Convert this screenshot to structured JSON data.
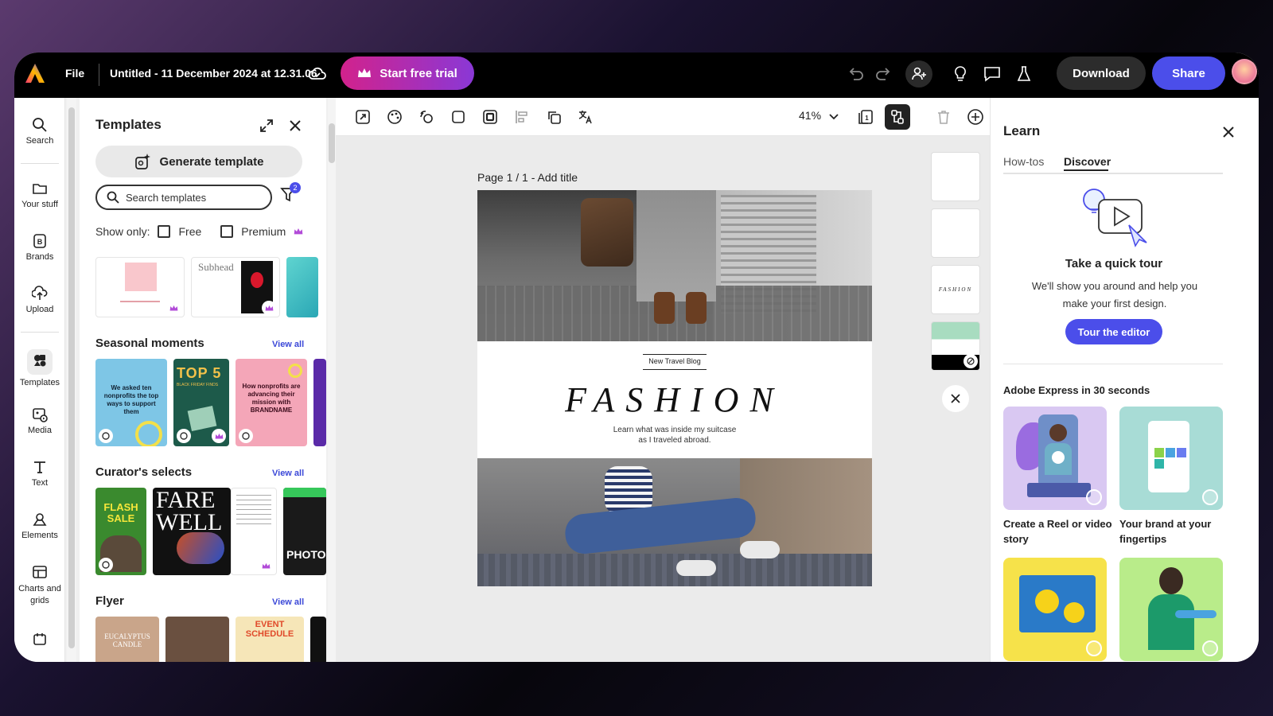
{
  "topbar": {
    "file_label": "File",
    "doc_title": "Untitled - 11 December 2024 at 12.31.06",
    "trial_label": "Start free trial",
    "download_label": "Download",
    "share_label": "Share"
  },
  "rail": {
    "items": [
      {
        "label": "Search",
        "icon": "search-icon"
      },
      {
        "label": "Your stuff",
        "icon": "folder-icon"
      },
      {
        "label": "Brands",
        "icon": "brand-icon"
      },
      {
        "label": "Upload",
        "icon": "upload-icon"
      },
      {
        "label": "Templates",
        "icon": "templates-icon"
      },
      {
        "label": "Media",
        "icon": "media-icon"
      },
      {
        "label": "Text",
        "icon": "text-icon"
      },
      {
        "label": "Elements",
        "icon": "elements-icon"
      },
      {
        "label": "Charts and grids",
        "icon": "charts-icon"
      }
    ]
  },
  "templates": {
    "title": "Templates",
    "generate_label": "Generate template",
    "search_placeholder": "Search templates",
    "filter_count": "2",
    "show_only": "Show only:",
    "free_label": "Free",
    "premium_label": "Premium",
    "top_thumb_subhead": "Subhead",
    "sections": [
      {
        "title": "Seasonal moments",
        "view_all": "View all"
      },
      {
        "title": "Curator's selects",
        "view_all": "View all"
      },
      {
        "title": "Flyer",
        "view_all": "View all"
      }
    ],
    "seasonal": [
      {
        "text": "We asked ten nonprofits the top ways to support them"
      },
      {
        "text": "TOP 5",
        "sub": "BLACK FRIDAY FINDS"
      },
      {
        "text": "How nonprofits are advancing their mission with BRANDNAME"
      }
    ],
    "curator": [
      {
        "text": "FLASH SALE"
      },
      {
        "text": "FARE WELL"
      },
      {
        "text": "PHOTO"
      }
    ],
    "flyer": [
      {
        "text": "EUCALYPTUS CANDLE"
      },
      {
        "text": ""
      },
      {
        "text": "EVENT SCHEDULE"
      }
    ]
  },
  "editor": {
    "zoom": "41%",
    "page_label": "Page 1 / 1 - Add title",
    "blog_label": "New Travel Blog",
    "headline": "FASHION",
    "tagline_1": "Learn what was inside my suitcase",
    "tagline_2": "as I traveled abroad.",
    "slot_text": "FASHION"
  },
  "learn": {
    "title": "Learn",
    "tab_howtos": "How-tos",
    "tab_discover": "Discover",
    "tour_title": "Take a quick tour",
    "tour_desc": "We'll show you around and help you make your first design.",
    "tour_button": "Tour the editor",
    "section_title": "Adobe Express in 30 seconds",
    "cards": [
      {
        "caption": "Create a Reel or video story",
        "color": "#d9c8f2"
      },
      {
        "caption": "Your brand at your fingertips",
        "color": "#a8dcd6"
      },
      {
        "caption": "",
        "color": "#f6e24a"
      },
      {
        "caption": "",
        "color": "#b9ec8a"
      }
    ]
  },
  "colors": {
    "accent": "#4b4eea",
    "trial_gradient_start": "#d2228c",
    "trial_gradient_end": "#8a38d6",
    "link": "#3b48d8"
  }
}
